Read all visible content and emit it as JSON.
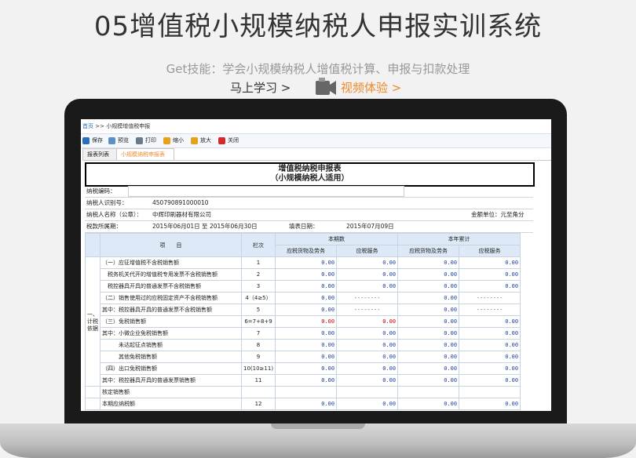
{
  "hero": {
    "title": "05增值税小规模纳税人申报实训系统",
    "subtitle": "Get技能：学会小规模纳税人增值税计算、申报与扣款处理",
    "learn_link": "马上学习 >",
    "video_link": "视频体验 >"
  },
  "app": {
    "breadcrumb_home": "首页",
    "breadcrumb_rest": ">> 小规模增值税申报",
    "toolbar": [
      {
        "label": "保存",
        "icon": "save-icon",
        "color": "#2a6fb8"
      },
      {
        "label": "预览",
        "icon": "preview-icon",
        "color": "#5a8fc8"
      },
      {
        "label": "打印",
        "icon": "print-icon",
        "color": "#6b7a8a"
      },
      {
        "label": "缩小",
        "icon": "zoom-out-icon",
        "color": "#e8a21a"
      },
      {
        "label": "放大",
        "icon": "zoom-in-icon",
        "color": "#e8a21a"
      },
      {
        "label": "关闭",
        "icon": "close-icon",
        "color": "#d42a2a"
      }
    ],
    "tabs": [
      "报表列表",
      "小规模纳税申报表"
    ],
    "form": {
      "title_line1": "增值税纳税申报表",
      "title_line2": "（小规模纳税人适用）",
      "taxpayer_code_label": "纳税编码：",
      "taxpayer_id_label": "纳税人识别号：",
      "taxpayer_id": "450790891000010",
      "taxpayer_name_label": "纳税人名称（公章）：",
      "taxpayer_name": "中辉印刷器材有限公司",
      "unit": "金额单位：元至角分",
      "period_label": "税款所属期：",
      "period": "2015年06月01日 至 2015年06月30日",
      "fill_date_label": "填表日期：",
      "fill_date": "2015年07月09日"
    },
    "table": {
      "h_item": "项　　目",
      "h_line": "栏次",
      "h_current": "本期数",
      "h_ytd": "本年累计",
      "h_goods": "应税货物及劳务",
      "h_service": "应税服务",
      "side_label": "一、计税依据",
      "rows": [
        {
          "item": "（一）应征增值税不含税销售额",
          "line": "1",
          "v": [
            "0.00",
            "0.00",
            "0.00",
            "0.00"
          ]
        },
        {
          "item": "　税务机关代开的增值税专用发票不含税销售额",
          "line": "2",
          "v": [
            "0.00",
            "0.00",
            "0.00",
            "0.00"
          ]
        },
        {
          "item": "　税控器具开具的普通发票不含税销售额",
          "line": "3",
          "v": [
            "0.00",
            "0.00",
            "0.00",
            "0.00"
          ]
        },
        {
          "item": "（二）销售使用过的应税固定资产不含税销售额",
          "line": "4（4≥5）",
          "v": [
            "0.00",
            "--------",
            "0.00",
            "--------"
          ]
        },
        {
          "item": "其中：税控器具开具的普通发票不含税销售额",
          "line": "5",
          "v": [
            "0.00",
            "--------",
            "0.00",
            "--------"
          ]
        },
        {
          "item": "（三）免税销售额",
          "line": "6=7+8+9",
          "v": [
            "0.00",
            "0.00",
            "0.00",
            "0.00"
          ],
          "red": true
        },
        {
          "item": "其中：小微企业免税销售额",
          "line": "7",
          "v": [
            "0.00",
            "0.00",
            "0.00",
            "0.00"
          ]
        },
        {
          "item": "　　　未达起征点销售额",
          "line": "8",
          "v": [
            "0.00",
            "0.00",
            "0.00",
            "0.00"
          ]
        },
        {
          "item": "　　　其他免税销售额",
          "line": "9",
          "v": [
            "0.00",
            "0.00",
            "0.00",
            "0.00"
          ]
        },
        {
          "item": "（四）出口免税销售额",
          "line": "10(10≥11)",
          "v": [
            "0.00",
            "0.00",
            "0.00",
            "0.00"
          ]
        },
        {
          "item": "其中：税控器具开具的普通发票销售额",
          "line": "11",
          "v": [
            "0.00",
            "0.00",
            "0.00",
            "0.00"
          ]
        },
        {
          "item": "核定销售额",
          "line": "",
          "v": [
            "",
            "",
            "",
            ""
          ]
        },
        {
          "item": "本期应纳税额",
          "line": "12",
          "v": [
            "0.00",
            "0.00",
            "0.00",
            "0.00"
          ]
        }
      ]
    }
  }
}
